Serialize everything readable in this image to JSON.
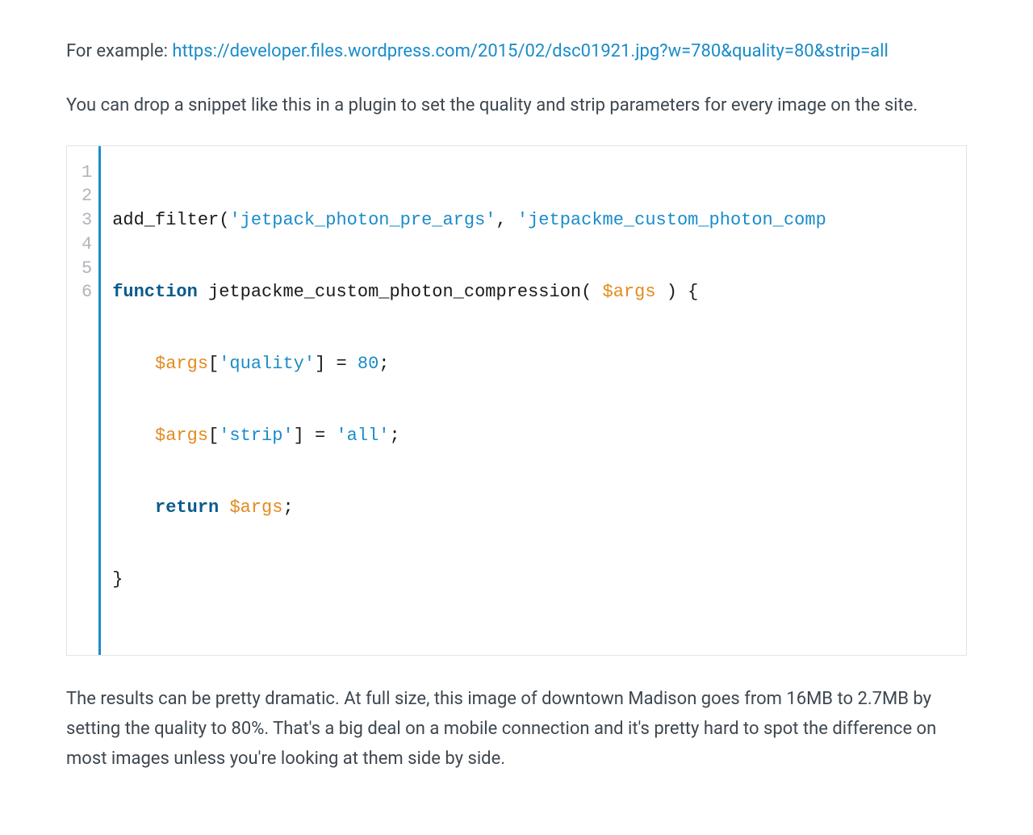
{
  "para1": {
    "prefix": "For example: ",
    "link": "https://developer.files.wordpress.com/2015/02/dsc01921.jpg?w=780&quality=80&strip=all"
  },
  "para2": "You can drop a snippet like this in a plugin to set the quality and strip parameters for every image on the site.",
  "para3": "The results can be pretty dramatic. At full size, this image of downtown Madison goes from 16MB to 2.7MB by setting the quality to 80%. That's a big deal on a mobile connection and it's pretty hard to spot the difference on most images unless you're looking at them side by side.",
  "code": {
    "line_numbers": [
      "1",
      "2",
      "3",
      "4",
      "5",
      "6"
    ],
    "l1": {
      "fn": "add_filter",
      "p1": "(",
      "s1": "'jetpack_photon_pre_args'",
      "c1": ", ",
      "s2": "'jetpackme_custom_photon_comp"
    },
    "l2": {
      "kw": "function",
      "sp": " ",
      "fn": "jetpackme_custom_photon_compression",
      "p1": "( ",
      "var": "$args",
      "p2": " ) {"
    },
    "l3": {
      "indent": "    ",
      "var": "$args",
      "b1": "[",
      "s": "'quality'",
      "b2": "] = ",
      "num": "80",
      "end": ";"
    },
    "l4": {
      "indent": "    ",
      "var": "$args",
      "b1": "[",
      "s": "'strip'",
      "b2": "] = ",
      "val": "'all'",
      "end": ";"
    },
    "l5": {
      "indent": "    ",
      "kw": "return",
      "sp": " ",
      "var": "$args",
      "end": ";"
    },
    "l6": {
      "brace": "}"
    }
  }
}
